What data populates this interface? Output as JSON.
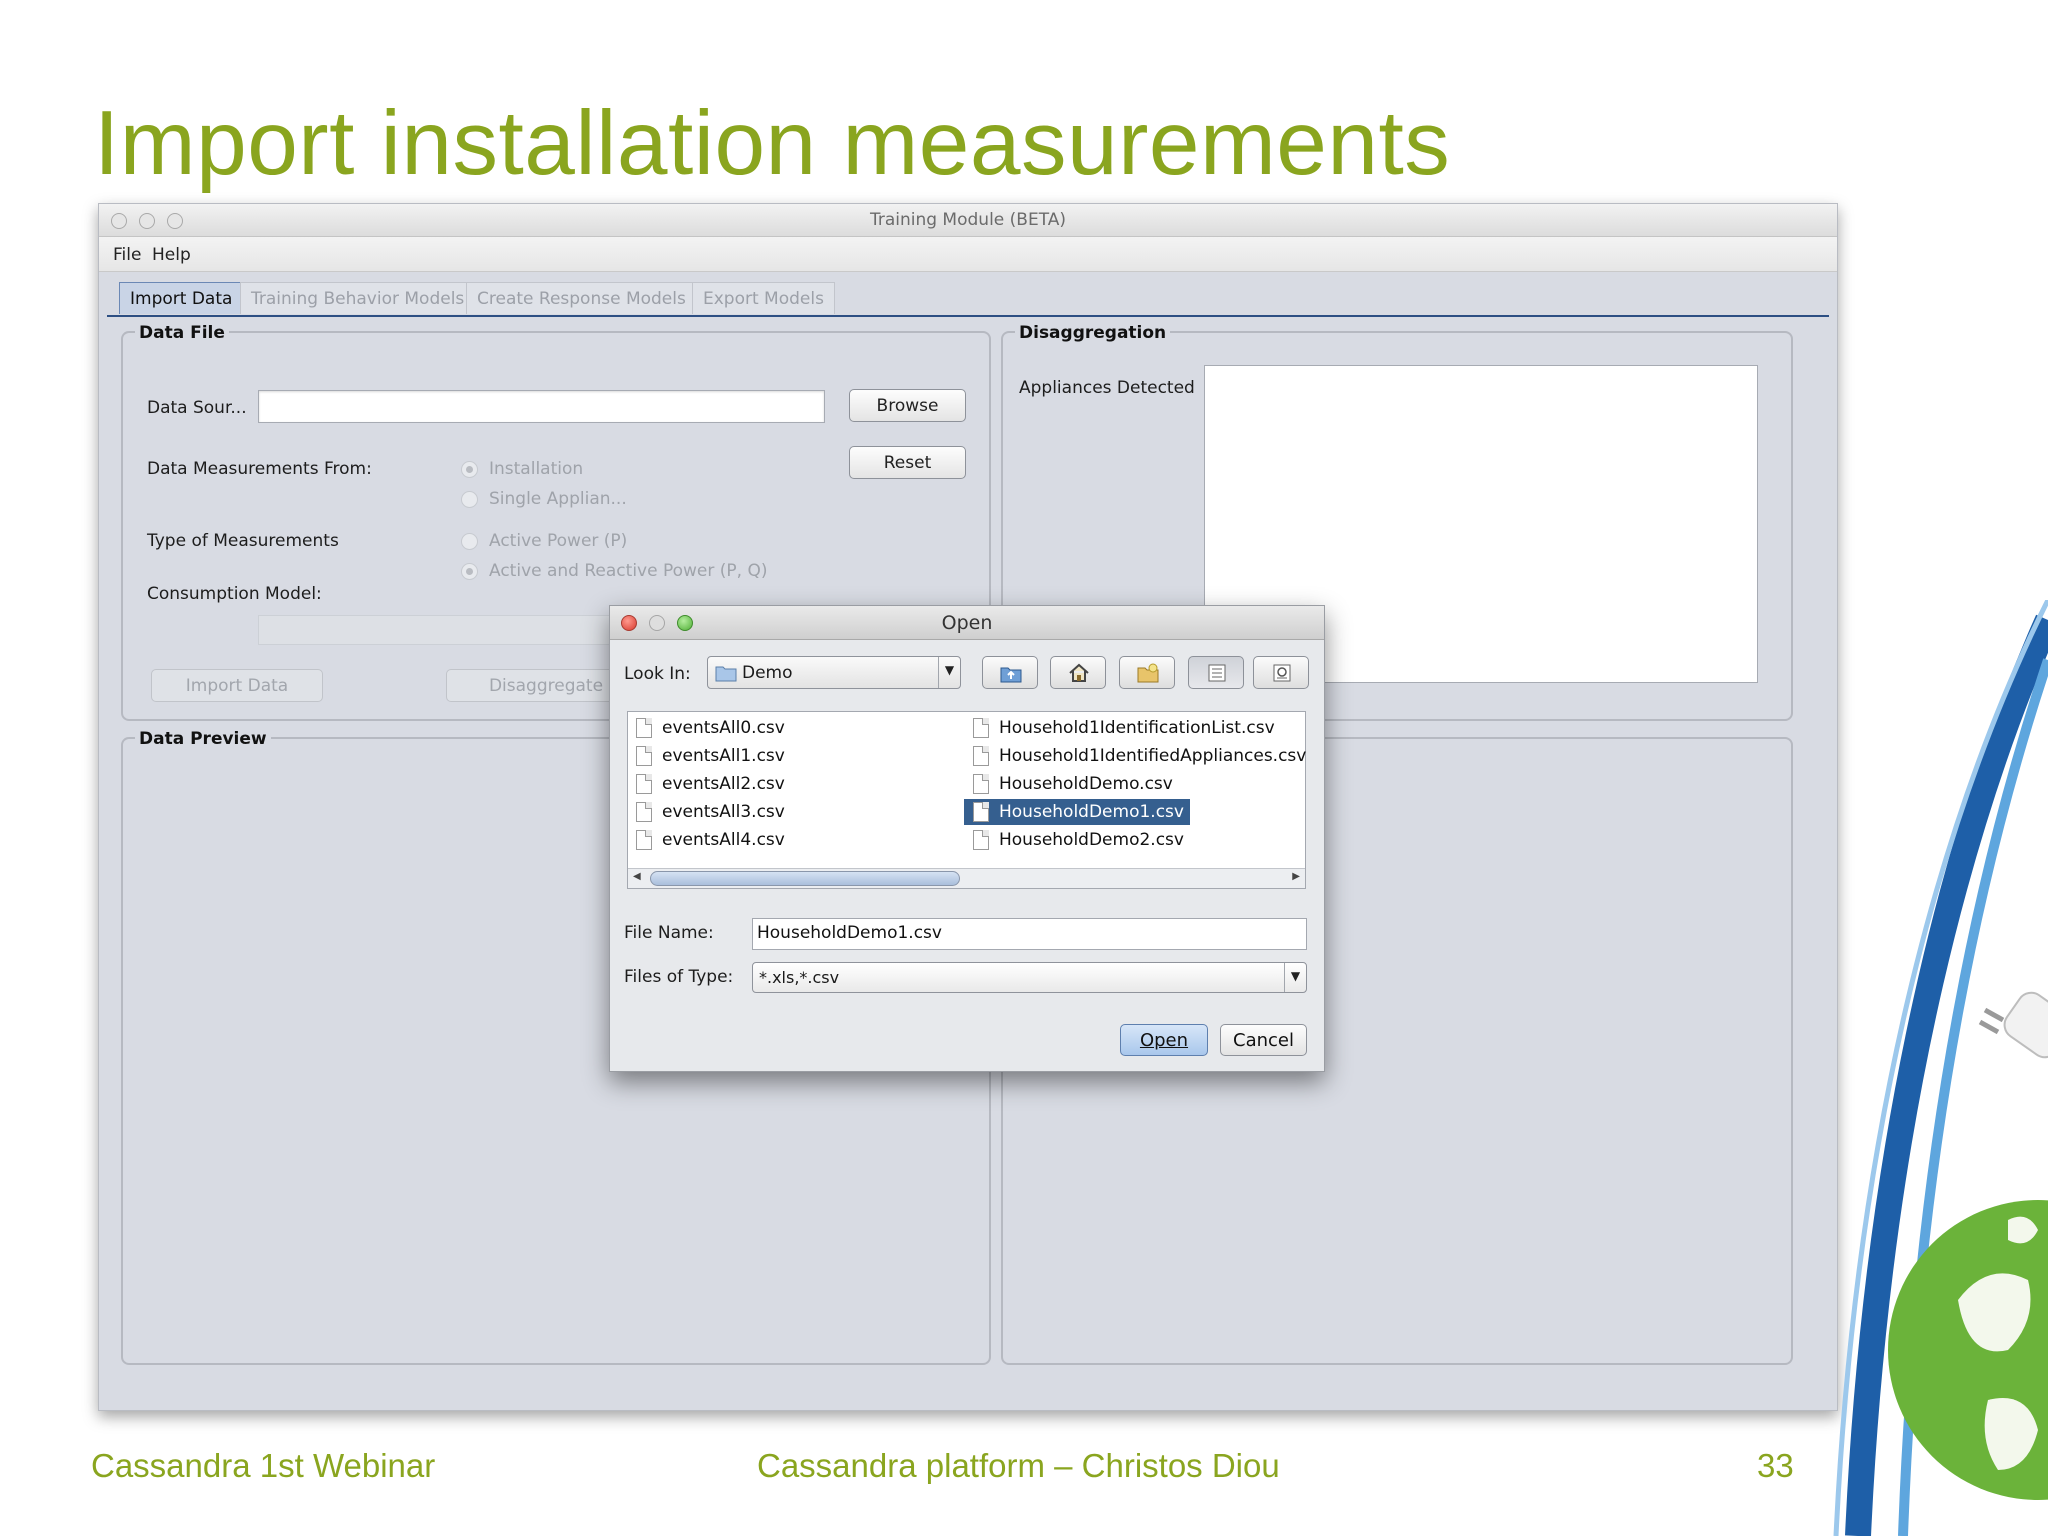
{
  "slide": {
    "title": "Import installation measurements",
    "footer_left": "Cassandra 1st Webinar",
    "footer_center": "Cassandra platform – Christos Diou",
    "page_number": "33"
  },
  "app": {
    "window_title": "Training Module (BETA)",
    "menu": [
      "File",
      "Help"
    ],
    "tabs": [
      "Import Data",
      "Training Behavior Models",
      "Create Response Models",
      "Export Models"
    ],
    "active_tab": "Import Data",
    "data_file": {
      "title": "Data File",
      "data_source_label": "Data Sour...",
      "data_source_value": "",
      "browse_label": "Browse",
      "reset_label": "Reset",
      "measurements_from_label": "Data Measurements From:",
      "measurements_from_options": [
        "Installation",
        "Single Applian..."
      ],
      "type_label": "Type of Measurements",
      "type_options": [
        "Active Power (P)",
        "Active and Reactive Power (P, Q)"
      ],
      "consumption_model_label": "Consumption Model:",
      "import_button": "Import Data",
      "disaggregate_button": "Disaggregate"
    },
    "disaggregation": {
      "title": "Disaggregation",
      "appliances_label": "Appliances Detected"
    },
    "data_preview": {
      "title": "Data Preview"
    }
  },
  "dialog": {
    "title": "Open",
    "look_in_label": "Look In:",
    "look_in_value": "Demo",
    "toolbar_icons": [
      "up-folder-icon",
      "home-icon",
      "new-folder-icon",
      "list-view-icon",
      "details-view-icon"
    ],
    "files": [
      "eventsAll0.csv",
      "eventsAll1.csv",
      "eventsAll2.csv",
      "eventsAll3.csv",
      "eventsAll4.csv",
      "Household1IdentificationList.csv",
      "Household1IdentifiedAppliances.csv",
      "HouseholdDemo.csv",
      "HouseholdDemo1.csv",
      "HouseholdDemo2.csv"
    ],
    "selected_file": "HouseholdDemo1.csv",
    "file_name_label": "File Name:",
    "file_name_value": "HouseholdDemo1.csv",
    "file_type_label": "Files of Type:",
    "file_type_value": "*.xls,*.csv",
    "open_label": "Open",
    "cancel_label": "Cancel"
  },
  "colors": {
    "accent_green": "#8aa51f",
    "selection_blue": "#355f8f",
    "tab_underline": "#2d4f83"
  }
}
